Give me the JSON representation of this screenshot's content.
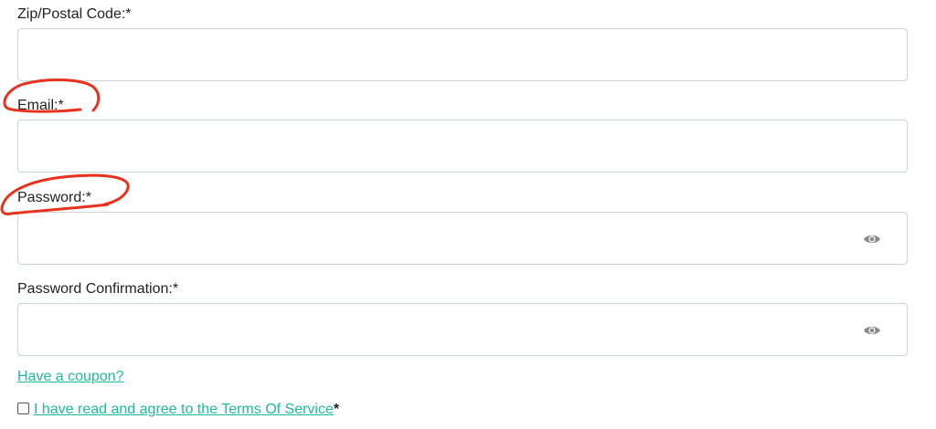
{
  "form": {
    "zip": {
      "label": "Zip/Postal Code:*",
      "value": "",
      "placeholder": ""
    },
    "email": {
      "label": "Email:*",
      "value": "",
      "placeholder": ""
    },
    "password": {
      "label": "Password:*",
      "value": "",
      "placeholder": "",
      "toggle_icon": "eye-icon"
    },
    "password_confirmation": {
      "label": "Password Confirmation:*",
      "value": "",
      "placeholder": "",
      "toggle_icon": "eye-icon"
    },
    "coupon_link": "Have a coupon?",
    "terms": {
      "checked": false,
      "link_text": "I have read and agree to the Terms Of Service",
      "required_mark": "*"
    }
  },
  "colors": {
    "link": "#1abc9c",
    "annotation": "#e8321e",
    "border": "#ced4da"
  },
  "annotations": {
    "type": "hand-drawn red circles",
    "targets": [
      "Email:*",
      "Password:*"
    ]
  }
}
